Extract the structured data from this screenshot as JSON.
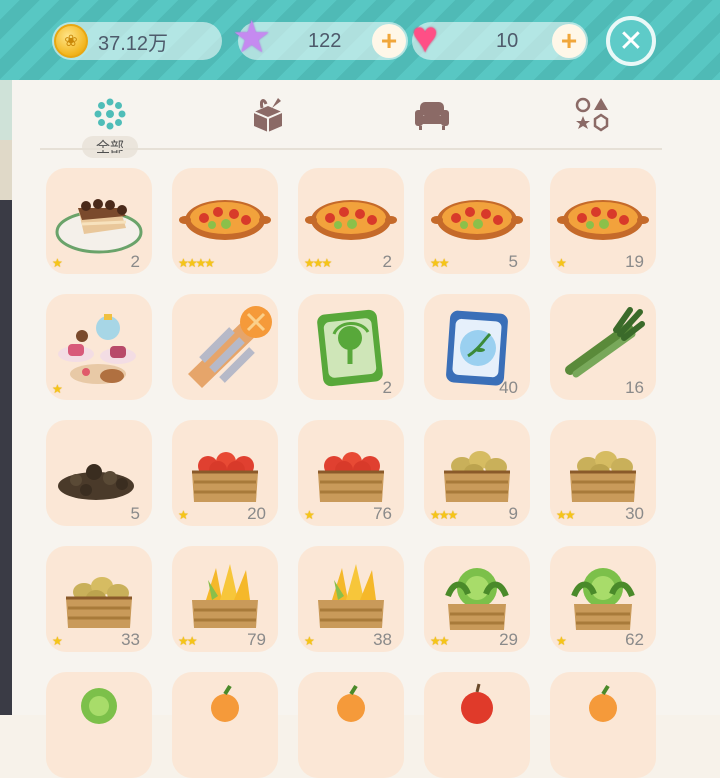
{
  "currency": {
    "coins": "37.12万",
    "stars": "122",
    "hearts": "10",
    "coin_icon": "coin-icon",
    "star_icon": "star-icon",
    "heart_icon": "heart-icon"
  },
  "tabs": [
    {
      "name": "all",
      "label": "全部",
      "icon": "flower-dots-icon",
      "active": true
    },
    {
      "name": "package",
      "label": "",
      "icon": "package-icon",
      "active": false
    },
    {
      "name": "furniture",
      "label": "",
      "icon": "sofa-icon",
      "active": false
    },
    {
      "name": "shapes",
      "label": "",
      "icon": "shapes-icon",
      "active": false
    }
  ],
  "colors": {
    "accent": "#58c7c3",
    "tile": "#fbe7d6",
    "star": "#f5c518"
  },
  "items": [
    {
      "name": "tiramisu",
      "stars": 1,
      "count": "2"
    },
    {
      "name": "paella",
      "stars": 4,
      "count": ""
    },
    {
      "name": "paella",
      "stars": 3,
      "count": "2"
    },
    {
      "name": "paella",
      "stars": 2,
      "count": "5"
    },
    {
      "name": "paella",
      "stars": 1,
      "count": "19"
    },
    {
      "name": "afternoon-tea",
      "stars": 1,
      "count": ""
    },
    {
      "name": "waffle-cone",
      "stars": 0,
      "count": ""
    },
    {
      "name": "seed-bag-green",
      "stars": 0,
      "count": "2"
    },
    {
      "name": "seed-bag-blue",
      "stars": 0,
      "count": "40"
    },
    {
      "name": "scallions",
      "stars": 0,
      "count": "16"
    },
    {
      "name": "soil",
      "stars": 0,
      "count": "5"
    },
    {
      "name": "tomato-crate",
      "stars": 1,
      "count": "20"
    },
    {
      "name": "tomato-crate",
      "stars": 1,
      "count": "76"
    },
    {
      "name": "potato-crate",
      "stars": 3,
      "count": "9"
    },
    {
      "name": "potato-crate",
      "stars": 2,
      "count": "30"
    },
    {
      "name": "potato-crate",
      "stars": 1,
      "count": "33"
    },
    {
      "name": "corn-crate",
      "stars": 2,
      "count": "79"
    },
    {
      "name": "corn-crate",
      "stars": 1,
      "count": "38"
    },
    {
      "name": "cabbage-crate",
      "stars": 2,
      "count": "29"
    },
    {
      "name": "cabbage-crate",
      "stars": 1,
      "count": "62"
    },
    {
      "name": "cabbage-partial",
      "stars": 0,
      "count": ""
    },
    {
      "name": "orange-partial",
      "stars": 0,
      "count": ""
    },
    {
      "name": "orange-partial",
      "stars": 0,
      "count": ""
    },
    {
      "name": "apple-partial",
      "stars": 0,
      "count": ""
    },
    {
      "name": "orange-partial",
      "stars": 0,
      "count": ""
    }
  ]
}
